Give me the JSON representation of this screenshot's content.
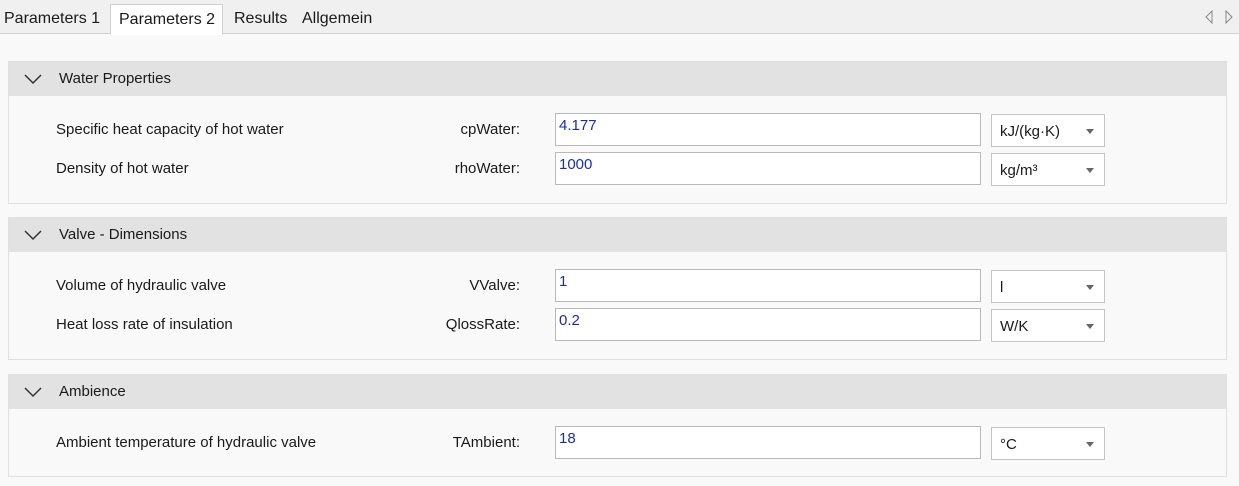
{
  "tabs": [
    {
      "label": "Parameters 1",
      "active": false
    },
    {
      "label": "Parameters 2",
      "active": true
    },
    {
      "label": "Results",
      "active": false
    },
    {
      "label": "Allgemein",
      "active": false
    }
  ],
  "tab_nav": {
    "prev_icon": "triangle-left-icon",
    "next_icon": "triangle-right-icon"
  },
  "sections": [
    {
      "title": "Water Properties",
      "rows": [
        {
          "label": "Specific heat capacity of hot water",
          "name": "cpWater:",
          "value": "4.177",
          "unit": "kJ/(kg·K)"
        },
        {
          "label": "Density of hot water",
          "name": "rhoWater:",
          "value": "1000",
          "unit": "kg/m³"
        }
      ]
    },
    {
      "title": "Valve - Dimensions",
      "rows": [
        {
          "label": "Volume of hydraulic valve",
          "name": "VValve:",
          "value": "1",
          "unit": "l"
        },
        {
          "label": "Heat loss rate of insulation",
          "name": "QlossRate:",
          "value": "0.2",
          "unit": "W/K"
        }
      ]
    },
    {
      "title": "Ambience",
      "rows": [
        {
          "label": "Ambient temperature of hydraulic valve",
          "name": "TAmbient:",
          "value": "18",
          "unit": "°C"
        }
      ]
    }
  ],
  "colors": {
    "value_text": "#1a2ea8",
    "header_bg": "#e2e2e2",
    "page_bg": "#f9f9f9"
  }
}
